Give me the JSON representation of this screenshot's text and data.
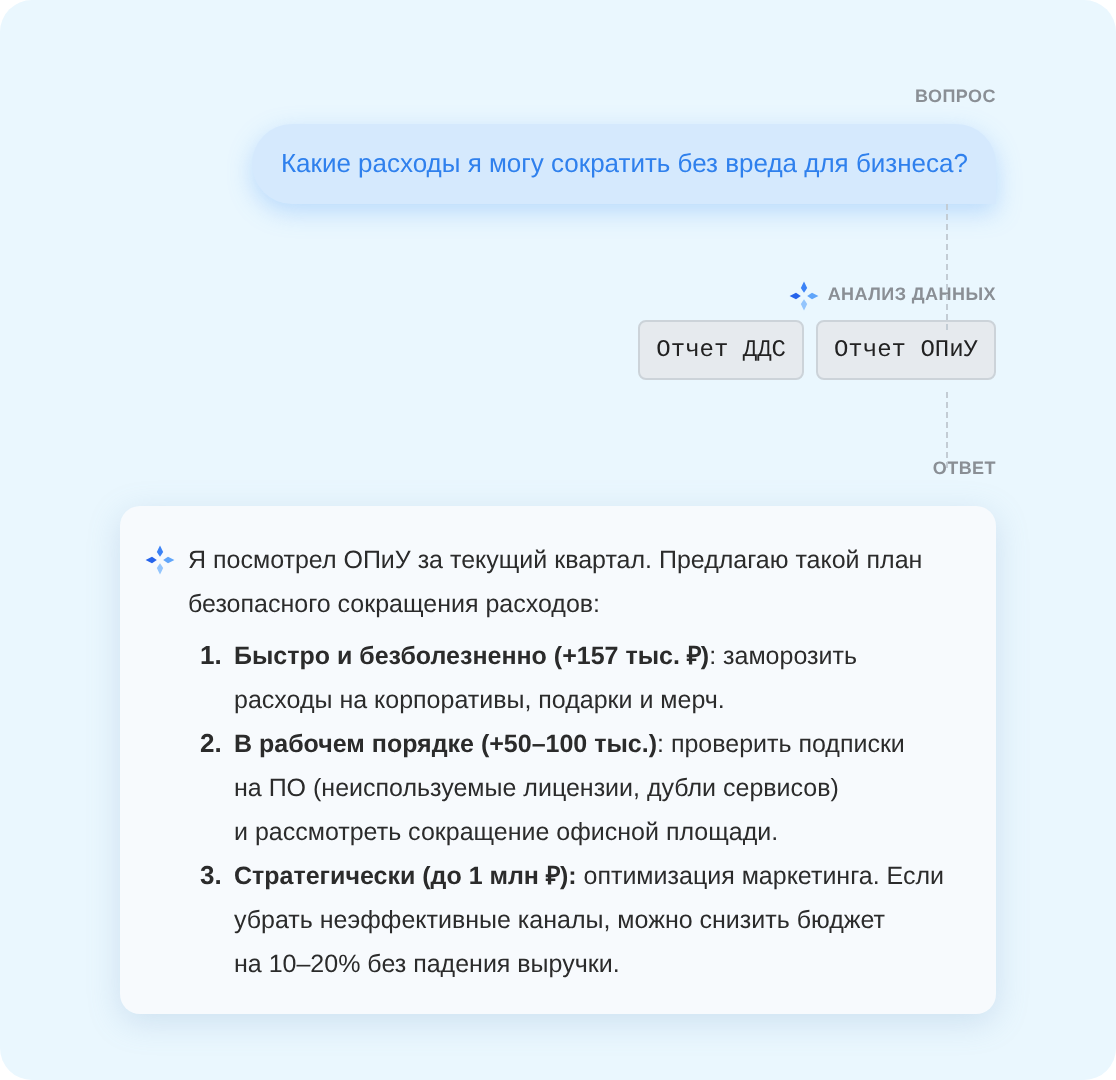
{
  "question": {
    "label": "ВОПРОС",
    "text": "Какие расходы я могу сократить без вреда для бизнеса?"
  },
  "analysis": {
    "label": "АНАЛИЗ ДАННЫХ",
    "chips": [
      "Отчет ДДС",
      "Отчет ОПиУ"
    ]
  },
  "answer": {
    "label": "ОТВЕТ",
    "intro": "Я посмотрел ОПиУ за текущий квартал. Предлагаю такой план\nбезопасного сокращения расходов:",
    "items": [
      {
        "number": "1.",
        "text": "**Быстро и безболезненно (+157 тыс. ₽)**: заморозить\nрасходы на корпоративы, подарки и мерч."
      },
      {
        "number": "2.",
        "text": "**В рабочем порядке (+50–100 тыс.)**: проверить подписки\nна ПО (неиспользуемые лицензии, дубли сервисов)\nи рассмотреть сокращение офисной площади."
      },
      {
        "number": "3.",
        "text": "**Стратегически (до 1 млн ₽):** оптимизация маркетинга. Если\nубрать неэффективные каналы, можно снизить бюджет\nна 10–20% без падения выручки."
      }
    ]
  }
}
